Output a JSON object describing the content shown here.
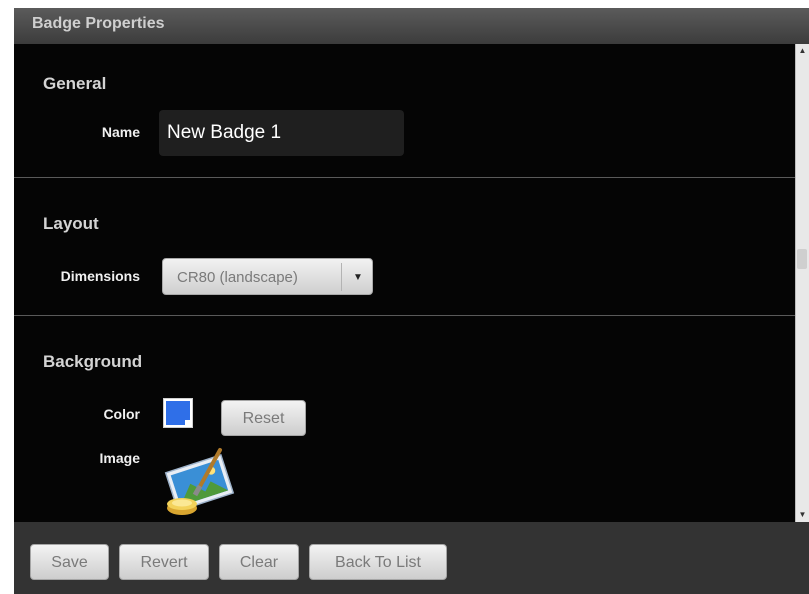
{
  "window": {
    "title": "Badge Properties"
  },
  "sections": {
    "general": {
      "title": "General",
      "name_label": "Name",
      "name_value": "New Badge 1"
    },
    "layout": {
      "title": "Layout",
      "dimensions_label": "Dimensions",
      "dimensions_value": "CR80 (landscape)"
    },
    "background": {
      "title": "Background",
      "color_label": "Color",
      "color_value": "#2f6fe8",
      "reset_label": "Reset",
      "image_label": "Image",
      "image_icon": "picture-paint-icon"
    }
  },
  "footer": {
    "save_label": "Save",
    "revert_label": "Revert",
    "clear_label": "Clear",
    "back_label": "Back To List"
  }
}
